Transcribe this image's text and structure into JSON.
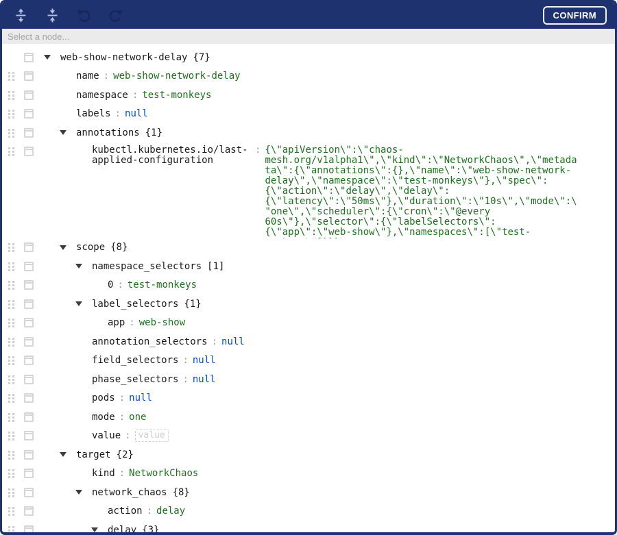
{
  "toolbar": {
    "confirm_label": "CONFIRM",
    "expand_all_label": "expand all",
    "collapse_all_label": "collapse all",
    "undo_label": "undo",
    "redo_label": "redo"
  },
  "breadcrumb": {
    "placeholder": "Select a node..."
  },
  "colors": {
    "navbar": "#1f3270",
    "toolbar-icon": "#b8c2dc",
    "toolbar-icon-disabled": "#17265c",
    "breadcrumb-bg": "#ebebeb",
    "string-value": "#1e701e",
    "null-value": "#004ed0"
  },
  "tree": {
    "rows": [
      {
        "depth": 0,
        "key": "web-show-network-delay",
        "count": "{7}",
        "expandable": true,
        "expanded": true,
        "drag": false
      },
      {
        "depth": 1,
        "key": "name",
        "value": "web-show-network-delay",
        "vtype": "string"
      },
      {
        "depth": 1,
        "key": "namespace",
        "value": "test-monkeys",
        "vtype": "string"
      },
      {
        "depth": 1,
        "key": "labels",
        "value": "null",
        "vtype": "null"
      },
      {
        "depth": 1,
        "key": "annotations",
        "count": "{1}",
        "expandable": true,
        "expanded": true
      },
      {
        "depth": 2,
        "key": "kubectl.kubernetes.io/last-applied-configuration",
        "value": "{\\\"apiVersion\\\":\\\"chaos-mesh.org/v1alpha1\\\",\\\"kind\\\":\\\"NetworkChaos\\\",\\\"metadata\\\":{\\\"annotations\\\":{},\\\"name\\\":\\\"web-show-network-delay\\\",\\\"namespace\\\":\\\"test-monkeys\\\"},\\\"spec\\\":{\\\"action\\\":\\\"delay\\\",\\\"delay\\\":{\\\"latency\\\":\\\"50ms\\\"},\\\"duration\\\":\\\"10s\\\",\\\"mode\\\":\\\"one\\\",\\\"scheduler\\\":{\\\"cron\\\":\\\"@every 60s\\\"},\\\"selector\\\":{\\\"labelSelectors\\\":{\\\"app\\\":\\\"web-show\\\"},\\\"namespaces\\\":[\\\"test-monkeys\\\"]}}}\\n",
        "vtype": "string",
        "wide": true
      },
      {
        "depth": 1,
        "key": "scope",
        "count": "{8}",
        "expandable": true,
        "expanded": true
      },
      {
        "depth": 2,
        "key": "namespace_selectors",
        "count": "[1]",
        "expandable": true,
        "expanded": true
      },
      {
        "depth": 3,
        "key": "0",
        "value": "test-monkeys",
        "vtype": "string"
      },
      {
        "depth": 2,
        "key": "label_selectors",
        "count": "{1}",
        "expandable": true,
        "expanded": true
      },
      {
        "depth": 3,
        "key": "app",
        "value": "web-show",
        "vtype": "string"
      },
      {
        "depth": 2,
        "key": "annotation_selectors",
        "value": "null",
        "vtype": "null"
      },
      {
        "depth": 2,
        "key": "field_selectors",
        "value": "null",
        "vtype": "null"
      },
      {
        "depth": 2,
        "key": "phase_selectors",
        "value": "null",
        "vtype": "null"
      },
      {
        "depth": 2,
        "key": "pods",
        "value": "null",
        "vtype": "null"
      },
      {
        "depth": 2,
        "key": "mode",
        "value": "one",
        "vtype": "string"
      },
      {
        "depth": 2,
        "key": "value",
        "value": "",
        "vtype": "empty",
        "placeholder": "value"
      },
      {
        "depth": 1,
        "key": "target",
        "count": "{2}",
        "expandable": true,
        "expanded": true
      },
      {
        "depth": 2,
        "key": "kind",
        "value": "NetworkChaos",
        "vtype": "string"
      },
      {
        "depth": 2,
        "key": "network_chaos",
        "count": "{8}",
        "expandable": true,
        "expanded": true
      },
      {
        "depth": 3,
        "key": "action",
        "value": "delay",
        "vtype": "string"
      },
      {
        "depth": 3,
        "key": "delay",
        "count": "{3}",
        "expandable": true,
        "expanded": true
      }
    ]
  }
}
